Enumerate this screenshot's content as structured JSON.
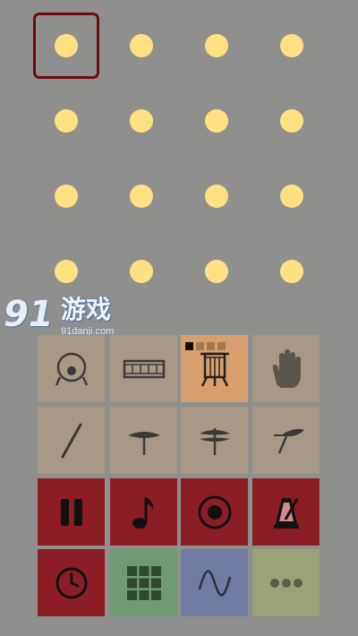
{
  "watermark": {
    "brand": "91",
    "name": "游戏",
    "url": "91danji.com"
  },
  "sequencer": {
    "columns": 4,
    "rows": 4,
    "selected_step": 1,
    "dot_color": "#ffe082",
    "highlight_color": "#6b0b0e"
  },
  "instruments": [
    {
      "id": "bass-drum",
      "icon": "bass-drum-icon",
      "color": "#a79985",
      "active": false
    },
    {
      "id": "snare-drum",
      "icon": "snare-drum-icon",
      "color": "#a79985",
      "active": false
    },
    {
      "id": "floor-tom",
      "icon": "floor-tom-icon",
      "color": "#d9a06f",
      "active": true,
      "variant_count": 4,
      "variant_selected": 1
    },
    {
      "id": "hand-clap",
      "icon": "hand-icon",
      "color": "#a79985",
      "active": false
    },
    {
      "id": "drumstick",
      "icon": "drumstick-icon",
      "color": "#a79985",
      "active": false
    },
    {
      "id": "closed-hihat",
      "icon": "closed-hihat-icon",
      "color": "#a79985",
      "active": false
    },
    {
      "id": "open-hihat",
      "icon": "open-hihat-icon",
      "color": "#a79985",
      "active": false
    },
    {
      "id": "crash-cymbal",
      "icon": "crash-cymbal-icon",
      "color": "#a79985",
      "active": false
    }
  ],
  "controls": [
    {
      "id": "pause",
      "icon": "pause-icon",
      "color": "#8c1d24"
    },
    {
      "id": "note",
      "icon": "music-note-icon",
      "color": "#8c1d24"
    },
    {
      "id": "record",
      "icon": "record-icon",
      "color": "#8c1d24"
    },
    {
      "id": "metronome",
      "icon": "metronome-icon",
      "color": "#8c1d24"
    },
    {
      "id": "tempo",
      "icon": "clock-icon",
      "color": "#8c1d24"
    },
    {
      "id": "pattern-grid",
      "icon": "grid-icon",
      "color": "#6f9b71"
    },
    {
      "id": "wave",
      "icon": "sine-wave-icon",
      "color": "#717ba3"
    },
    {
      "id": "more",
      "icon": "more-icon",
      "color": "#9aa277"
    }
  ]
}
